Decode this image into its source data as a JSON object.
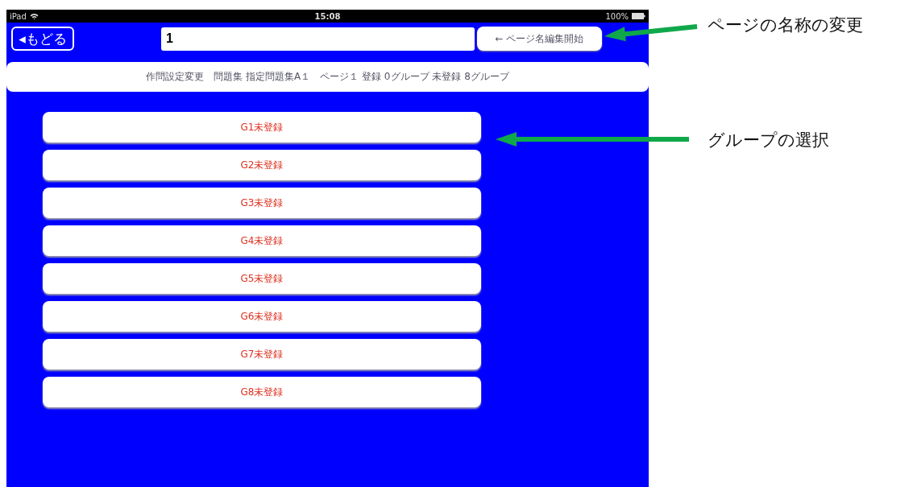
{
  "status_bar": {
    "carrier": "iPad",
    "time": "15:08",
    "battery": "100%"
  },
  "nav": {
    "back_button": "◂もどる",
    "page_name_field": {
      "value": "1"
    },
    "edit_button": "← ページ名編集開始"
  },
  "info_bar": "作問設定変更　問題集 指定問題集A１　ページ１ 登録 0グループ 未登録 8グループ",
  "groups": [
    {
      "label": "G1未登録"
    },
    {
      "label": "G2未登録"
    },
    {
      "label": "G3未登録"
    },
    {
      "label": "G4未登録"
    },
    {
      "label": "G5未登録"
    },
    {
      "label": "G6未登録"
    },
    {
      "label": "G7未登録"
    },
    {
      "label": "G8未登録"
    }
  ],
  "annotations": [
    {
      "text": "ページの名称の変更"
    },
    {
      "text": "グループの選択"
    }
  ]
}
